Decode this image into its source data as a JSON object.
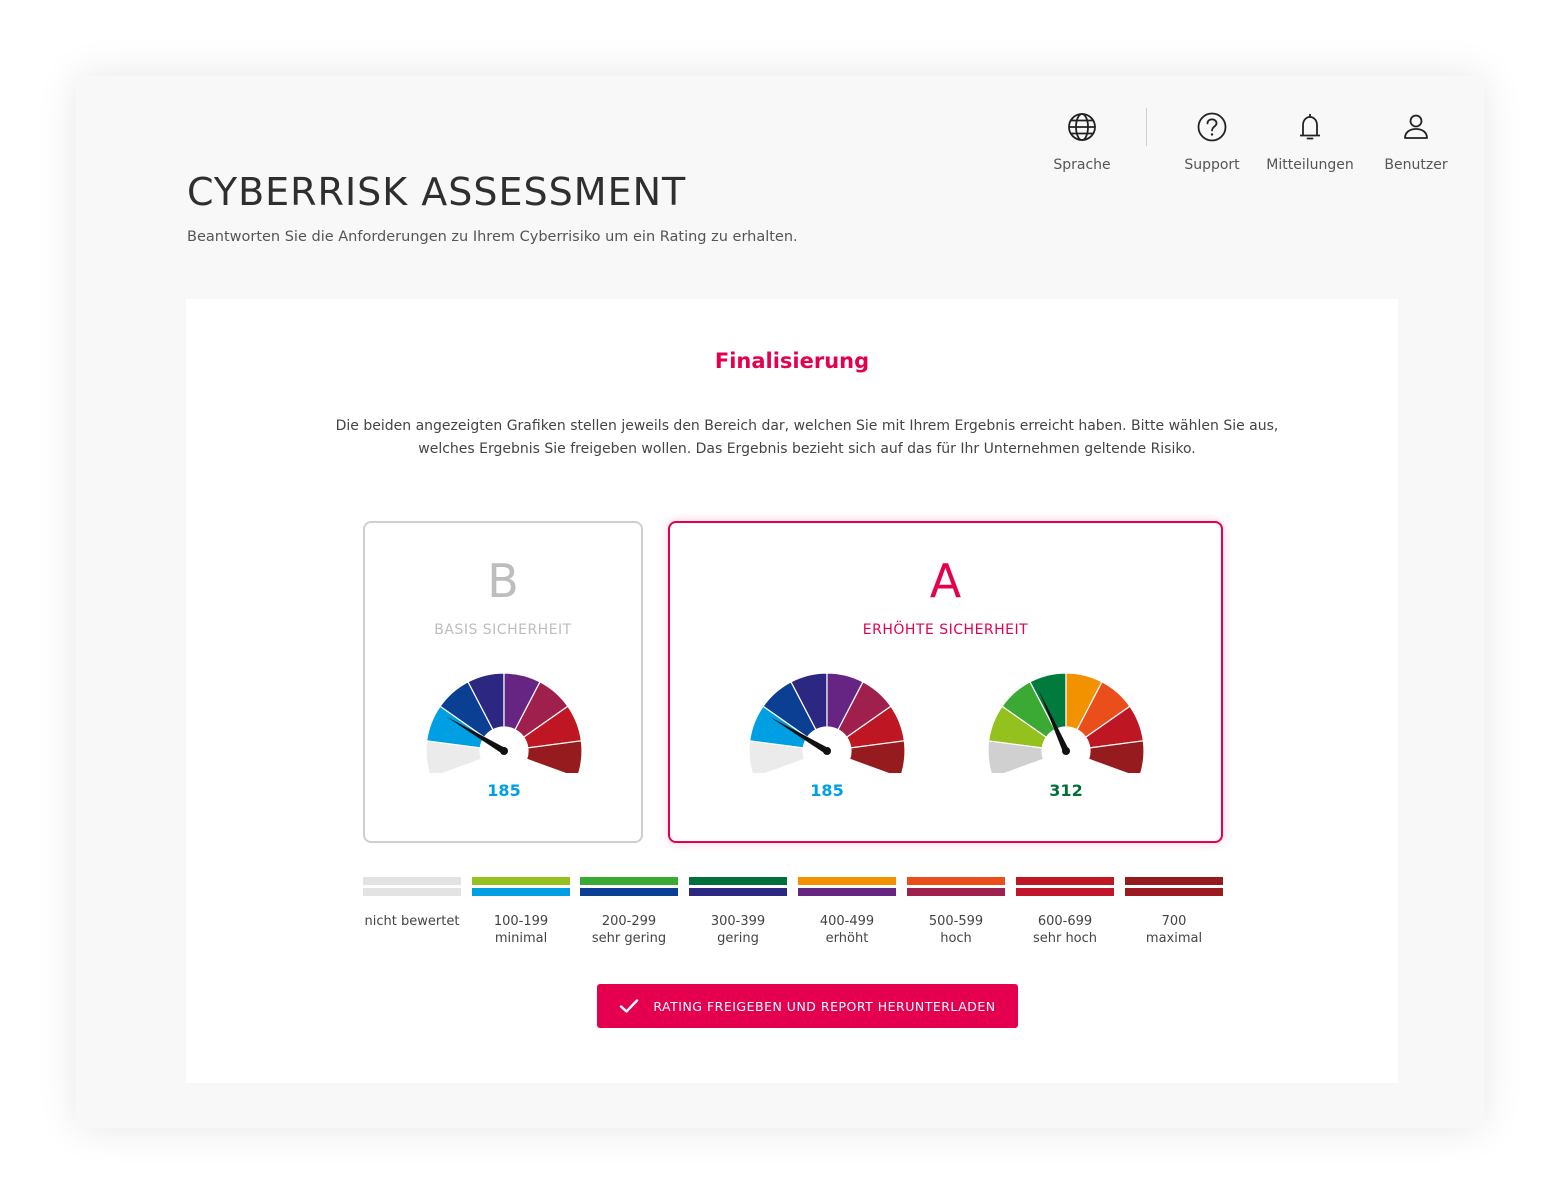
{
  "nav": {
    "items": [
      {
        "label": "Sprache",
        "icon": "globe-icon"
      },
      {
        "label": "Support",
        "icon": "help-circle-icon"
      },
      {
        "label": "Mitteilungen",
        "icon": "bell-icon"
      },
      {
        "label": "Benutzer",
        "icon": "user-icon"
      }
    ]
  },
  "header": {
    "title": "CYBERRISK ASSESSMENT",
    "subtitle": "Beantworten Sie die Anforderungen zu Ihrem Cyberrisiko um ein Rating zu erhalten."
  },
  "card": {
    "title": "Finalisierung",
    "description_line1": "Die beiden angezeigten Grafiken stellen jeweils den Bereich dar, welchen Sie mit Ihrem Ergebnis erreicht haben. Bitte wählen Sie aus,",
    "description_line2": "welches Ergebnis Sie freigeben wollen. Das Ergebnis bezieht sich auf das für Ihr Unternehmen geltende Risiko."
  },
  "options": {
    "b": {
      "letter": "B",
      "label": "BASIS SICHERHEIT",
      "selected": false
    },
    "a": {
      "letter": "A",
      "label": "ERHÖHTE SICHERHEIT",
      "selected": true
    }
  },
  "gauges": {
    "basis": {
      "value": "185",
      "score": 185,
      "palette": "blue",
      "value_color": "#009fe3"
    },
    "erhoeht_1": {
      "value": "185",
      "score": 185,
      "palette": "blue",
      "value_color": "#009fe3"
    },
    "erhoeht_2": {
      "value": "312",
      "score": 312,
      "palette": "green",
      "value_color": "#006f3c"
    }
  },
  "palettes": {
    "blue": [
      "#ebebeb",
      "#009fe3",
      "#0a3f94",
      "#2c2780",
      "#662583",
      "#a0204d",
      "#be1622",
      "#951b1f"
    ],
    "green": [
      "#d0d0d0",
      "#95c11f",
      "#3aaa35",
      "#007a3d",
      "#f39200",
      "#e94e1b",
      "#be1622",
      "#951b1f"
    ]
  },
  "legend": [
    {
      "range": "",
      "label": "nicht bewertet",
      "top_color": "#e3e3e3",
      "bottom_color": "#e3e3e3"
    },
    {
      "range": "100-199",
      "label": "minimal",
      "top_color": "#95c11f",
      "bottom_color": "#009fe3"
    },
    {
      "range": "200-299",
      "label": "sehr gering",
      "top_color": "#3aaa35",
      "bottom_color": "#0a3f94"
    },
    {
      "range": "300-399",
      "label": "gering",
      "top_color": "#006f3c",
      "bottom_color": "#2c2780"
    },
    {
      "range": "400-499",
      "label": "erhöht",
      "top_color": "#f39200",
      "bottom_color": "#662583"
    },
    {
      "range": "500-599",
      "label": "hoch",
      "top_color": "#e94e1b",
      "bottom_color": "#a0204d"
    },
    {
      "range": "600-699",
      "label": "sehr hoch",
      "top_color": "#be1622",
      "bottom_color": "#c0152b"
    },
    {
      "range": "700",
      "label": "maximal",
      "top_color": "#951b1f",
      "bottom_color": "#9c1a1f"
    }
  ],
  "actions": {
    "submit_label": "RATING FREIGEBEN UND REPORT HERUNTERLADEN"
  },
  "colors": {
    "accent": "#e5004f",
    "muted_border": "#cfcfcf"
  }
}
